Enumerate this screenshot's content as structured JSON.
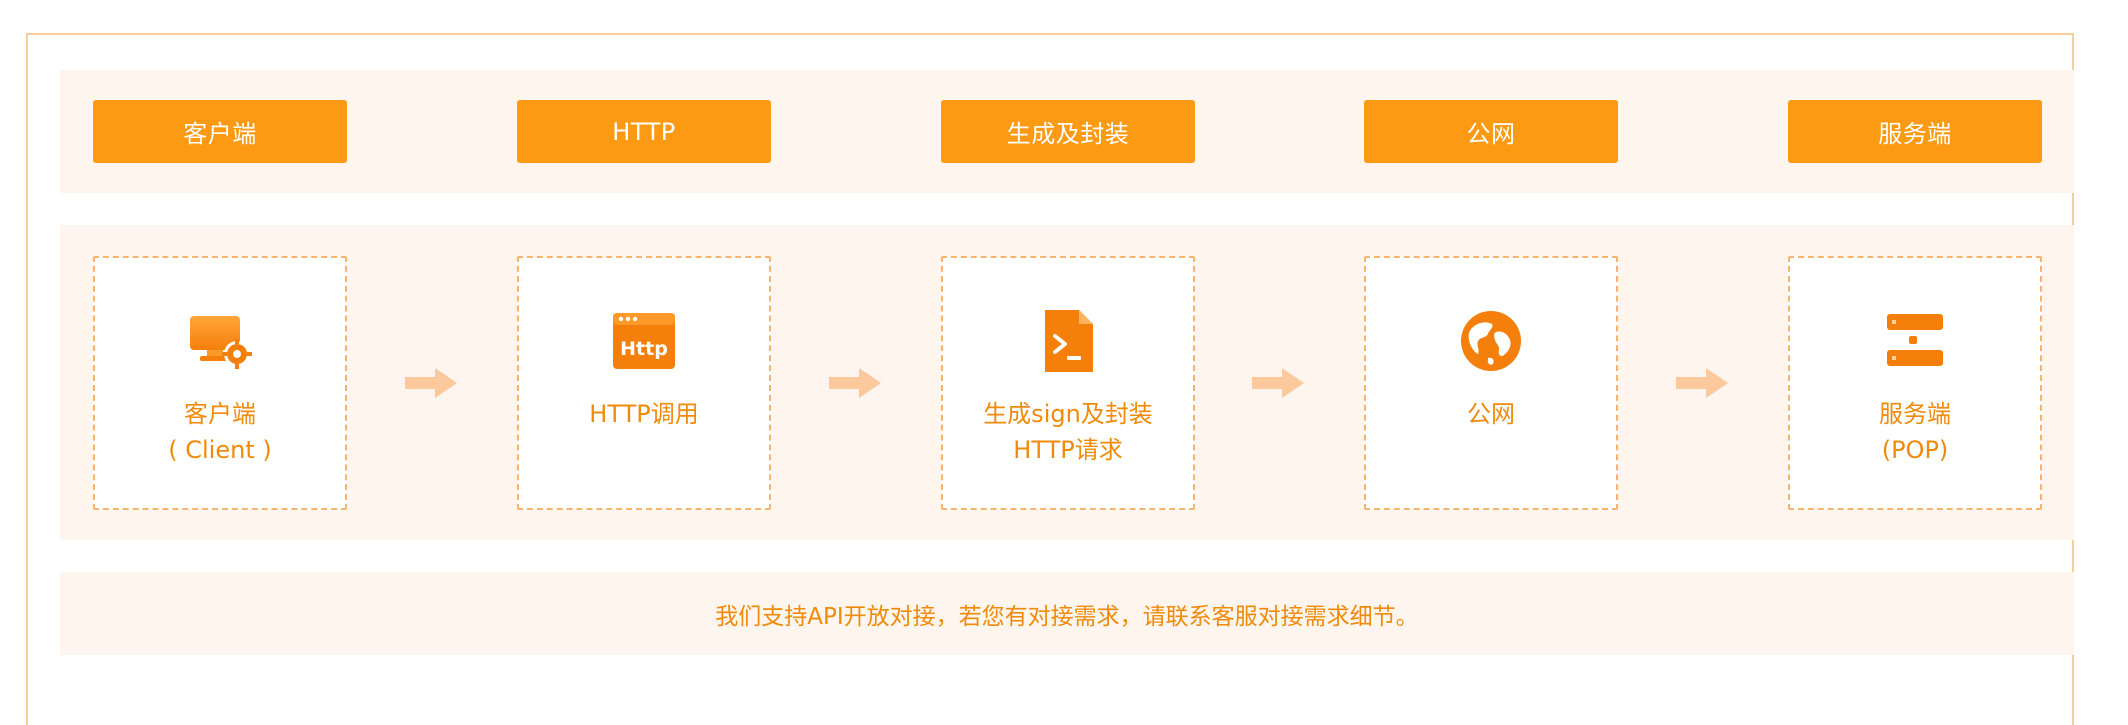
{
  "header": {
    "steps": [
      {
        "label": "客户端"
      },
      {
        "label": "HTTP"
      },
      {
        "label": "生成及封装"
      },
      {
        "label": "公网"
      },
      {
        "label": "服务端"
      }
    ]
  },
  "flow": {
    "steps": [
      {
        "line1": "客户端",
        "line2": "( Client )",
        "icon": "monitor-gear-icon"
      },
      {
        "line1": "HTTP调用",
        "line2": "",
        "icon": "http-window-icon"
      },
      {
        "line1": "生成sign及封装",
        "line2": "HTTP请求",
        "icon": "terminal-file-icon"
      },
      {
        "line1": "公网",
        "line2": "",
        "icon": "globe-icon"
      },
      {
        "line1": "服务端",
        "line2": "(POP)",
        "icon": "server-icon"
      }
    ],
    "icon_http_text": "Http"
  },
  "notice": {
    "text": "我们支持API开放对接，若您有对接需求，请联系客服对接需求细节。"
  },
  "colors": {
    "accent": "#fd9a13",
    "accent_text": "#f08a0a",
    "band_bg": "#fdf5ee",
    "dashed_border": "#f9b36a",
    "arrow": "#fbc99b"
  }
}
